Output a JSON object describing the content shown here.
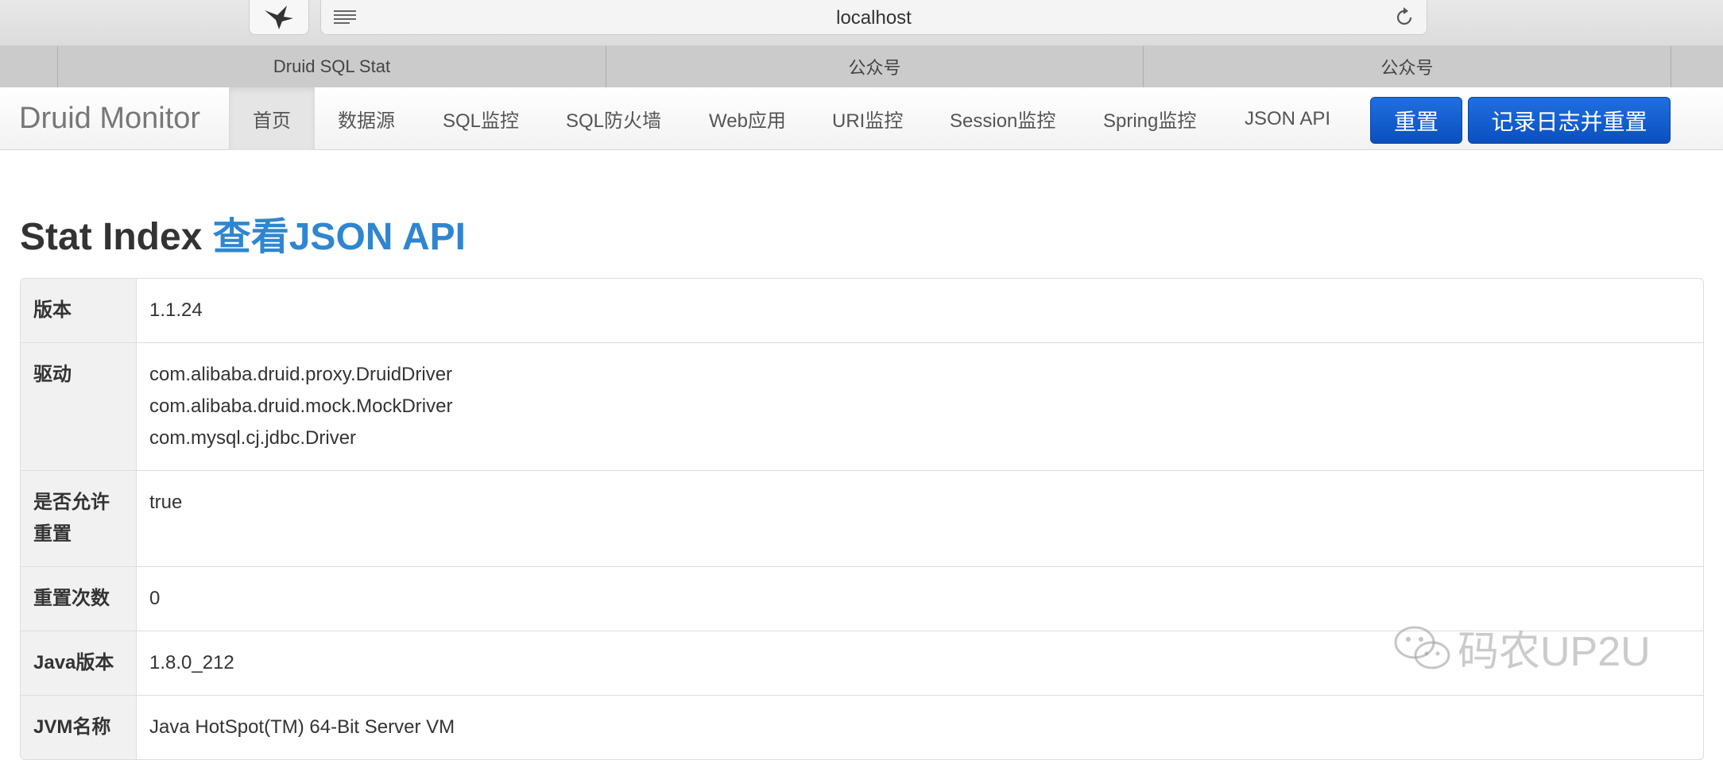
{
  "browser": {
    "url": "localhost",
    "tabs": [
      {
        "label": "Druid SQL Stat"
      },
      {
        "label": "公众号"
      },
      {
        "label": "公众号"
      }
    ]
  },
  "navbar": {
    "brand": "Druid Monitor",
    "items": [
      {
        "label": "首页",
        "active": true
      },
      {
        "label": "数据源"
      },
      {
        "label": "SQL监控"
      },
      {
        "label": "SQL防火墙"
      },
      {
        "label": "Web应用"
      },
      {
        "label": "URI监控"
      },
      {
        "label": "Session监控"
      },
      {
        "label": "Spring监控"
      },
      {
        "label": "JSON API"
      }
    ],
    "reset_button": "重置",
    "log_reset_button": "记录日志并重置"
  },
  "page": {
    "title": "Stat Index",
    "json_link": "查看JSON API"
  },
  "stats": [
    {
      "label": "版本",
      "values": [
        "1.1.24"
      ]
    },
    {
      "label": "驱动",
      "values": [
        "com.alibaba.druid.proxy.DruidDriver",
        "com.alibaba.druid.mock.MockDriver",
        "com.mysql.cj.jdbc.Driver"
      ]
    },
    {
      "label": "是否允许重置",
      "values": [
        "true"
      ]
    },
    {
      "label": "重置次数",
      "values": [
        "0"
      ]
    },
    {
      "label": "Java版本",
      "values": [
        "1.8.0_212"
      ]
    },
    {
      "label": "JVM名称",
      "values": [
        "Java HotSpot(TM) 64-Bit Server VM"
      ]
    }
  ],
  "watermark": "码农UP2U",
  "colors": {
    "primary_button": "#0b4fbf",
    "link": "#2f86d0"
  }
}
